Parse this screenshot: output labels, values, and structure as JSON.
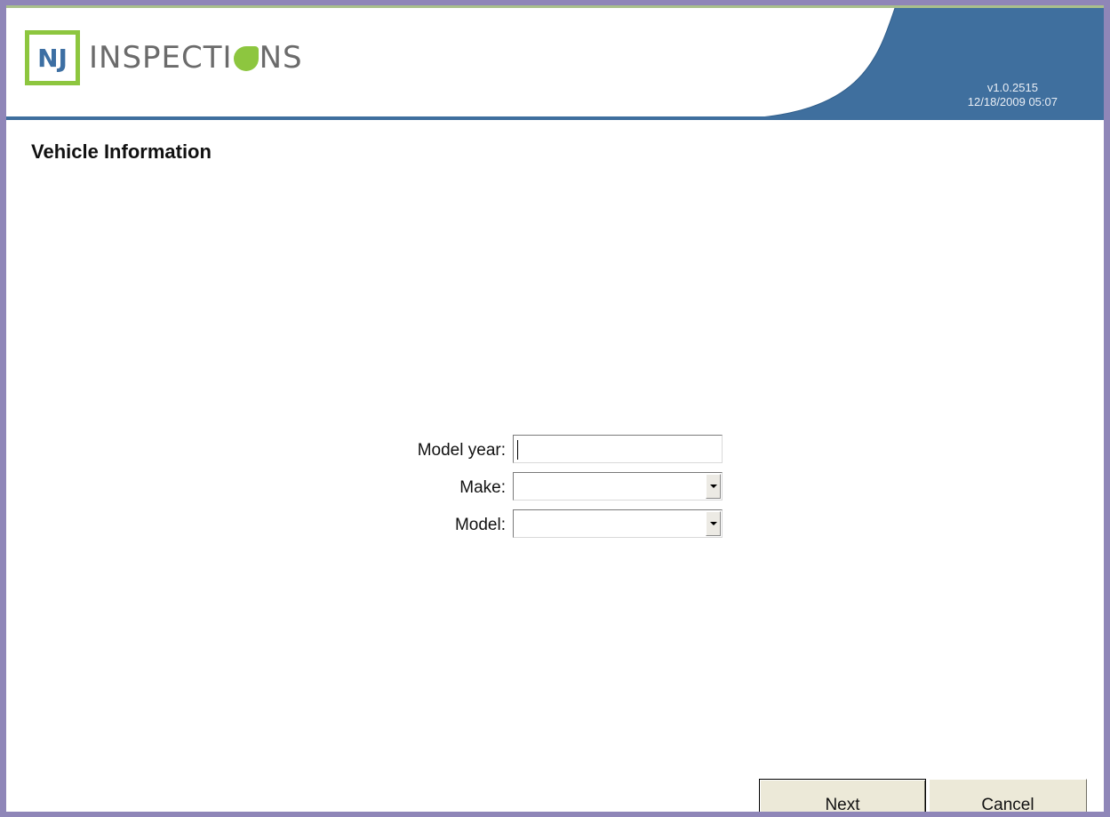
{
  "app": {
    "logo_nj": "NJ",
    "logo_name_prefix": "INSPECTI",
    "logo_name_suffix": "NS",
    "version": "v1.0.2515",
    "datetime": "12/18/2009 05:07"
  },
  "page": {
    "title": "Vehicle Information"
  },
  "form": {
    "model_year": {
      "label": "Model year:",
      "value": ""
    },
    "make": {
      "label": "Make:",
      "value": ""
    },
    "model": {
      "label": "Model:",
      "value": ""
    }
  },
  "buttons": {
    "next": "Next",
    "cancel": "Cancel"
  },
  "colors": {
    "header_accent": "#3f6f9e",
    "logo_green": "#8dc63f",
    "logo_blue": "#3d6fa3",
    "window_border": "#8f86b8"
  },
  "icons": {
    "dropdown": "chevron-down-icon",
    "logo_o": "leaf-icon"
  }
}
